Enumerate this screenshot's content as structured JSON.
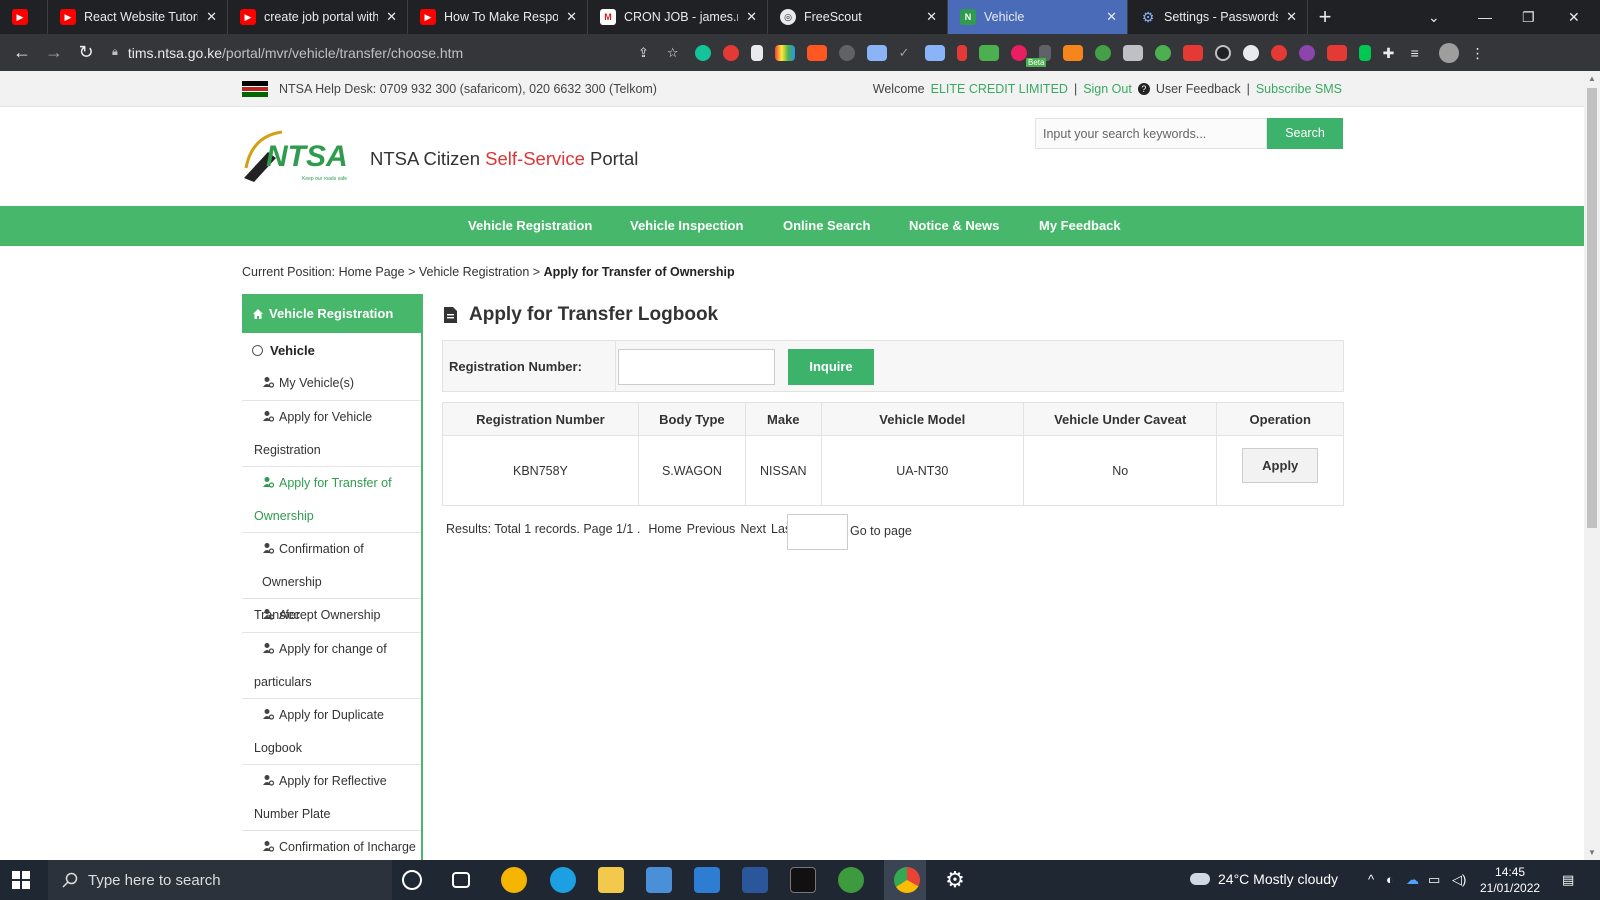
{
  "browser": {
    "tabs": [
      {
        "label": "",
        "favicon": "youtube-icon",
        "color": "#ff0000"
      },
      {
        "label": "React Website Tutorial",
        "favicon": "youtube-icon",
        "color": "#ff0000"
      },
      {
        "label": "create job portal with l",
        "favicon": "youtube-icon",
        "color": "#ff0000"
      },
      {
        "label": "How To Make Respons",
        "favicon": "youtube-icon",
        "color": "#ff0000"
      },
      {
        "label": "CRON JOB - james.ndu",
        "favicon": "gmail-icon",
        "color": "#c5221f"
      },
      {
        "label": "FreeScout",
        "favicon": "globe-icon",
        "color": "#e8eaed"
      },
      {
        "label": "Vehicle",
        "favicon": "ntsa-icon",
        "color": "#2f9b4e"
      },
      {
        "label": "Settings - Passwords",
        "favicon": "gear-icon",
        "color": "#8ab4f8"
      }
    ],
    "close_glyph": "✕",
    "new_tab_glyph": "+",
    "url_host": "tims.ntsa.go.ke",
    "url_path": "/portal/mvr/vehicle/transfer/choose.htm",
    "extension_badge": "Beta"
  },
  "site": {
    "helpdesk": "NTSA Help Desk: 0709 932 300 (safaricom), 020 6632 300 (Telkom)",
    "welcome": "Welcome",
    "user": "ELITE CREDIT LIMITED",
    "sep": "|",
    "sign_out": "Sign Out",
    "user_feedback": "User Feedback",
    "subscribe": "Subscribe SMS",
    "logo_text": "NTSA",
    "logo_tagline": "Keep our roads safe",
    "portal_title_a": "NTSA Citizen ",
    "portal_title_b": "Self-Service",
    "portal_title_c": " Portal",
    "search_placeholder": "Input your search keywords...",
    "search_button": "Search",
    "nav": [
      "Vehicle Registration",
      "Vehicle Inspection",
      "Online Search",
      "Notice & News",
      "My Feedback"
    ],
    "breadcrumb_prefix": "Current Position: ",
    "breadcrumb_home": "Home Page",
    "breadcrumb_sep": " > ",
    "breadcrumb_section": "Vehicle Registration",
    "breadcrumb_current": "Apply for Transfer of Ownership"
  },
  "sidebar": {
    "header": "Vehicle Registration",
    "group": "Vehicle",
    "items": [
      {
        "l1": "My Vehicle(s)",
        "l2": ""
      },
      {
        "l1": "Apply for Vehicle",
        "l2": "Registration"
      },
      {
        "l1": "Apply for Transfer of",
        "l2": "Ownership"
      },
      {
        "l1": "Confirmation of Ownership",
        "l2": "Transfer"
      },
      {
        "l1": "Accept Ownership",
        "l2": ""
      },
      {
        "l1": "Apply for change of",
        "l2": "particulars"
      },
      {
        "l1": "Apply for Duplicate",
        "l2": "Logbook"
      },
      {
        "l1": "Apply for Reflective",
        "l2": "Number Plate"
      },
      {
        "l1": "Confirmation of Incharge",
        "l2": ""
      }
    ]
  },
  "main": {
    "title": "Apply for Transfer Logbook",
    "reg_label": "Registration Number:",
    "reg_value": "",
    "inquire": "Inquire",
    "table": {
      "headers": [
        "Registration Number",
        "Body Type",
        "Make",
        "Vehicle Model",
        "Vehicle Under Caveat",
        "Operation"
      ],
      "rows": [
        {
          "reg": "KBN758Y",
          "body": "S.WAGON",
          "make": "NISSAN",
          "model": "UA-NT30",
          "caveat": "No",
          "action": "Apply"
        }
      ]
    },
    "pager": {
      "results": "Results: Total 1 records. Page 1/1 .",
      "home": "Home",
      "previous": "Previous",
      "next": "Next",
      "last": "Last",
      "goto": "Go to page"
    }
  },
  "taskbar": {
    "search_placeholder": "Type here to search",
    "weather": "24°C  Mostly cloudy",
    "time": "14:45",
    "date": "21/01/2022"
  },
  "colors": {
    "brand_green": "#47b76b",
    "accent_red": "#e03434",
    "link_green": "#3aa962"
  }
}
